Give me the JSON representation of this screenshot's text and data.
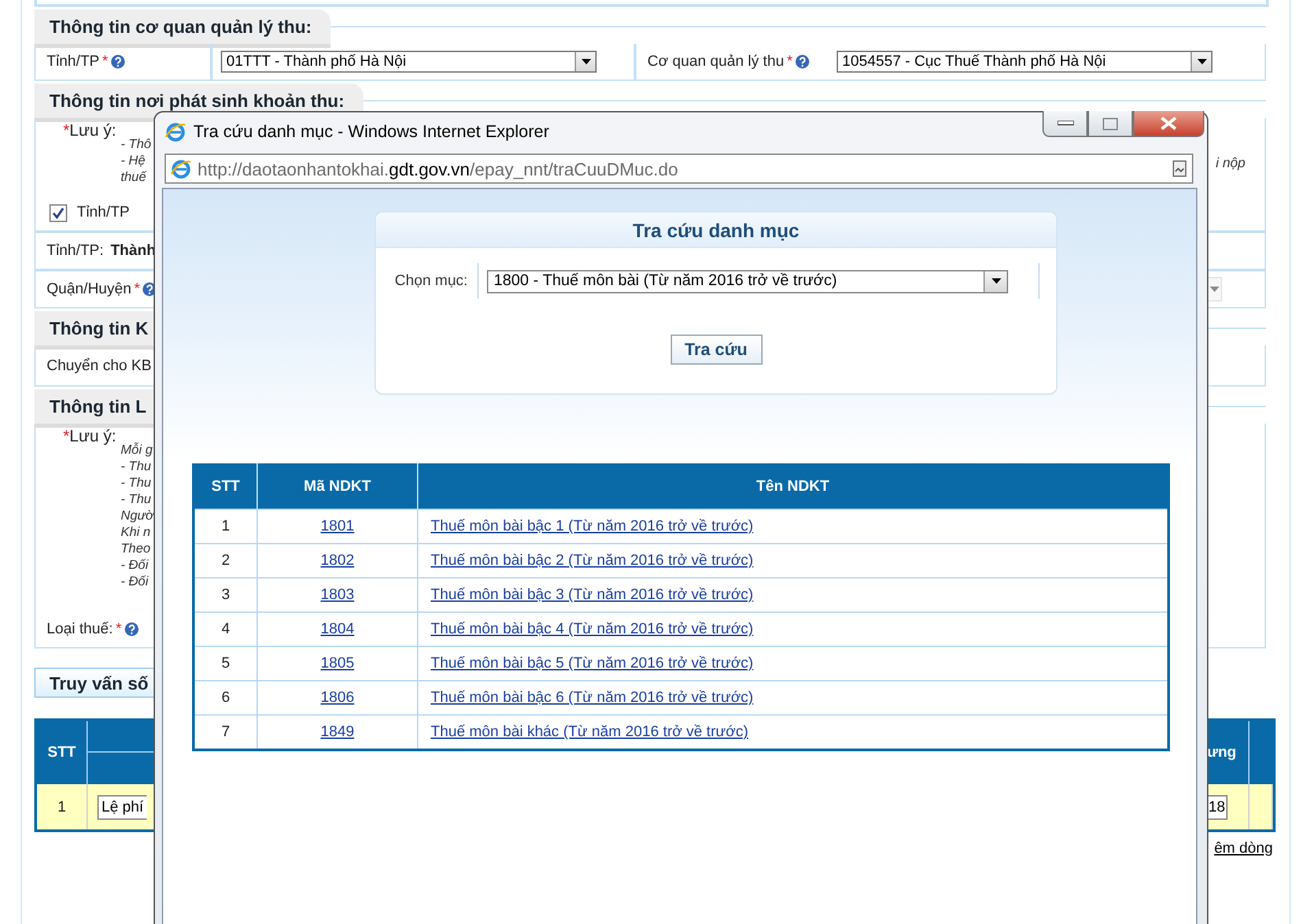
{
  "collection_agency": {
    "title": "Thông tin cơ quan quản lý thu:",
    "fields": [
      {
        "label": "Tỉnh/TP",
        "mark": "*",
        "help": true,
        "value": "01TTT - Thành phố Hà Nội"
      },
      {
        "label": "Cơ quan quản lý thu",
        "mark": "*",
        "help": true,
        "value": "1054557 - Cục Thuế Thành phố Hà Nội"
      }
    ]
  },
  "origin": {
    "title": "Thông tin nơi phát sinh khoản thu:",
    "note_mark": "*",
    "note_label": "Lưu ý:",
    "note_lines": [
      "- Thô",
      "- Hệ",
      "thuế"
    ],
    "note_tail": "i nộp",
    "checkbox": {
      "label": "Tỉnh/TP",
      "checked": true
    },
    "province": {
      "label": "Tỉnh/TP:",
      "value": "Thành"
    },
    "district": {
      "label": "Quận/Huyện",
      "mark": "*",
      "help": true,
      "disabled": true
    }
  },
  "treasury": {
    "title": "Thông tin K",
    "label": "Chuyển cho KB"
  },
  "levy": {
    "title": "Thông tin L",
    "note_mark": "*",
    "note_label": "Lưu ý:",
    "note_lines": [
      "Mỗi g",
      "- Thu",
      "- Thu",
      "- Thu",
      "Ngườ",
      "Khi n",
      "Theo",
      "- Đối",
      "- Đối"
    ],
    "tax_type": {
      "label": "Loại thuế:",
      "mark": "*",
      "help": true
    }
  },
  "query": {
    "title": "Truy vấn số"
  },
  "items_table": {
    "columns": [
      "STT",
      "ưng"
    ],
    "rows": [
      {
        "stt": "1",
        "name": "Lệ phí",
        "amount": "18"
      }
    ]
  },
  "add_row_link": "êm dòng",
  "popup": {
    "title": "Tra cứu danh mục - Windows Internet Explorer",
    "url_parts": [
      {
        "text": "http://daotaonhantokhai.",
        "highlighted": false
      },
      {
        "text": "gdt.gov.vn",
        "highlighted": true
      },
      {
        "text": "/epay_nnt/traCuuDMuc.do",
        "highlighted": false
      }
    ],
    "panel_title": "Tra cứu danh mục",
    "select_label": "Chọn mục:",
    "select_value": "1800 - Thuế môn bài (Từ năm 2016 trở về trước)",
    "search_button": "Tra cứu",
    "table": {
      "columns": [
        "STT",
        "Mã NDKT",
        "Tên NDKT"
      ],
      "rows": [
        {
          "stt": "1",
          "code": "1801",
          "name": "Thuế môn bài bậc 1 (Từ năm 2016 trở về trước)"
        },
        {
          "stt": "2",
          "code": "1802",
          "name": "Thuế môn bài bậc 2 (Từ năm 2016 trở về trước)"
        },
        {
          "stt": "3",
          "code": "1803",
          "name": "Thuế môn bài bậc 3 (Từ năm 2016 trở về trước)"
        },
        {
          "stt": "4",
          "code": "1804",
          "name": "Thuế môn bài bậc 4 (Từ năm 2016 trở về trước)"
        },
        {
          "stt": "5",
          "code": "1805",
          "name": "Thuế môn bài bậc 5 (Từ năm 2016 trở về trước)"
        },
        {
          "stt": "6",
          "code": "1806",
          "name": "Thuế môn bài bậc 6 (Từ năm 2016 trở về trước)"
        },
        {
          "stt": "7",
          "code": "1849",
          "name": "Thuế môn bài khác (Từ năm 2016 trở về trước)"
        }
      ]
    }
  }
}
